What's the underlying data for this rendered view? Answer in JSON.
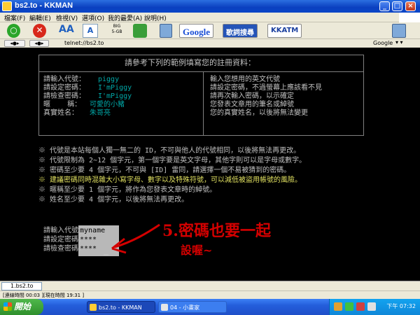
{
  "window": {
    "title": "bs2.to - KKMAN"
  },
  "menu": [
    "檔案(F)",
    "編輯(E)",
    "檢視(V)",
    "選項(O)",
    "我的最愛(A)",
    "說明(H)"
  ],
  "toolbar": {
    "google_label": "Google",
    "search_label": "歌詞搜尋",
    "kkatm_label": "KKATM"
  },
  "address": {
    "url": "telnet://bs2.to",
    "search_engine": "Google"
  },
  "terminal": {
    "header": "請參考下列的範例填寫您的註冊資料：",
    "examples": [
      {
        "label": "請輸入代號：",
        "value": "piggy",
        "desc": "輸入您想用的英文代號"
      },
      {
        "label": "請設定密碼：",
        "value": "I'mPiggy",
        "desc": "請設定密碼，不過螢幕上應該看不見"
      },
      {
        "label": "請檢查密碼：",
        "value": "I'mPiggy",
        "desc": "請再次輸入密碼，以示確定"
      },
      {
        "label": "暱    稱：",
        "value": "可愛的小豬",
        "desc": "您發表文章用的筆名或綽號"
      },
      {
        "label": "真實姓名：",
        "value": "朱哥亮",
        "desc": "您的真實姓名，以後將無法變更"
      }
    ],
    "notes": [
      {
        "text": "※ 代號是本站每個人獨一無二的 ID，不可與他人的代號相同，以後將無法再更改。",
        "highlight": false
      },
      {
        "text": "※ 代號限制為 2~12 個字元，第一個字要是英文字母，其他字則可以是字母或數字。",
        "highlight": false
      },
      {
        "text": "※ 密碼至少要 4 個字元，不可與 [ID] 雷同，請選擇一個不易被猜到的密碼。",
        "highlight": false
      },
      {
        "text": "※ 建議密碼同時混雜大小寫字母、數字以及特殊符號，可以減低被盜用帳號的風險。",
        "highlight": true
      },
      {
        "text": "※ 暱稱至少要 1 個字元，將作為您發表文章時的綽號。",
        "highlight": false
      },
      {
        "text": "※ 姓名至少要 4 個字元，以後將無法再更改。",
        "highlight": false
      }
    ],
    "form": [
      {
        "label": "請輸入代號：",
        "value": "myname"
      },
      {
        "label": "請設定密碼：",
        "value": "****"
      },
      {
        "label": "請檢查密碼：",
        "value": "****"
      }
    ],
    "annotation_line1": "5.密碼也要一起",
    "annotation_line2": "設喔~"
  },
  "tab": {
    "label": "1.bs2.to"
  },
  "status": {
    "connect_time": "[連線時間 00:03 ]",
    "current_time": "[現在時間 19:31 ]"
  },
  "taskbar": {
    "start_label": "開始",
    "tasks": [
      "bs2.to - KKMAN",
      "04 - 小畫家"
    ],
    "clock": "下午 07:32"
  },
  "colors": {
    "title_blue": "#0a3fbf",
    "terminal_bg": "#000000",
    "terminal_text": "#c0c0c0",
    "cyan": "#00a7a7",
    "highlight_yellow": "#e0e060",
    "annotation_red": "#d40000"
  }
}
